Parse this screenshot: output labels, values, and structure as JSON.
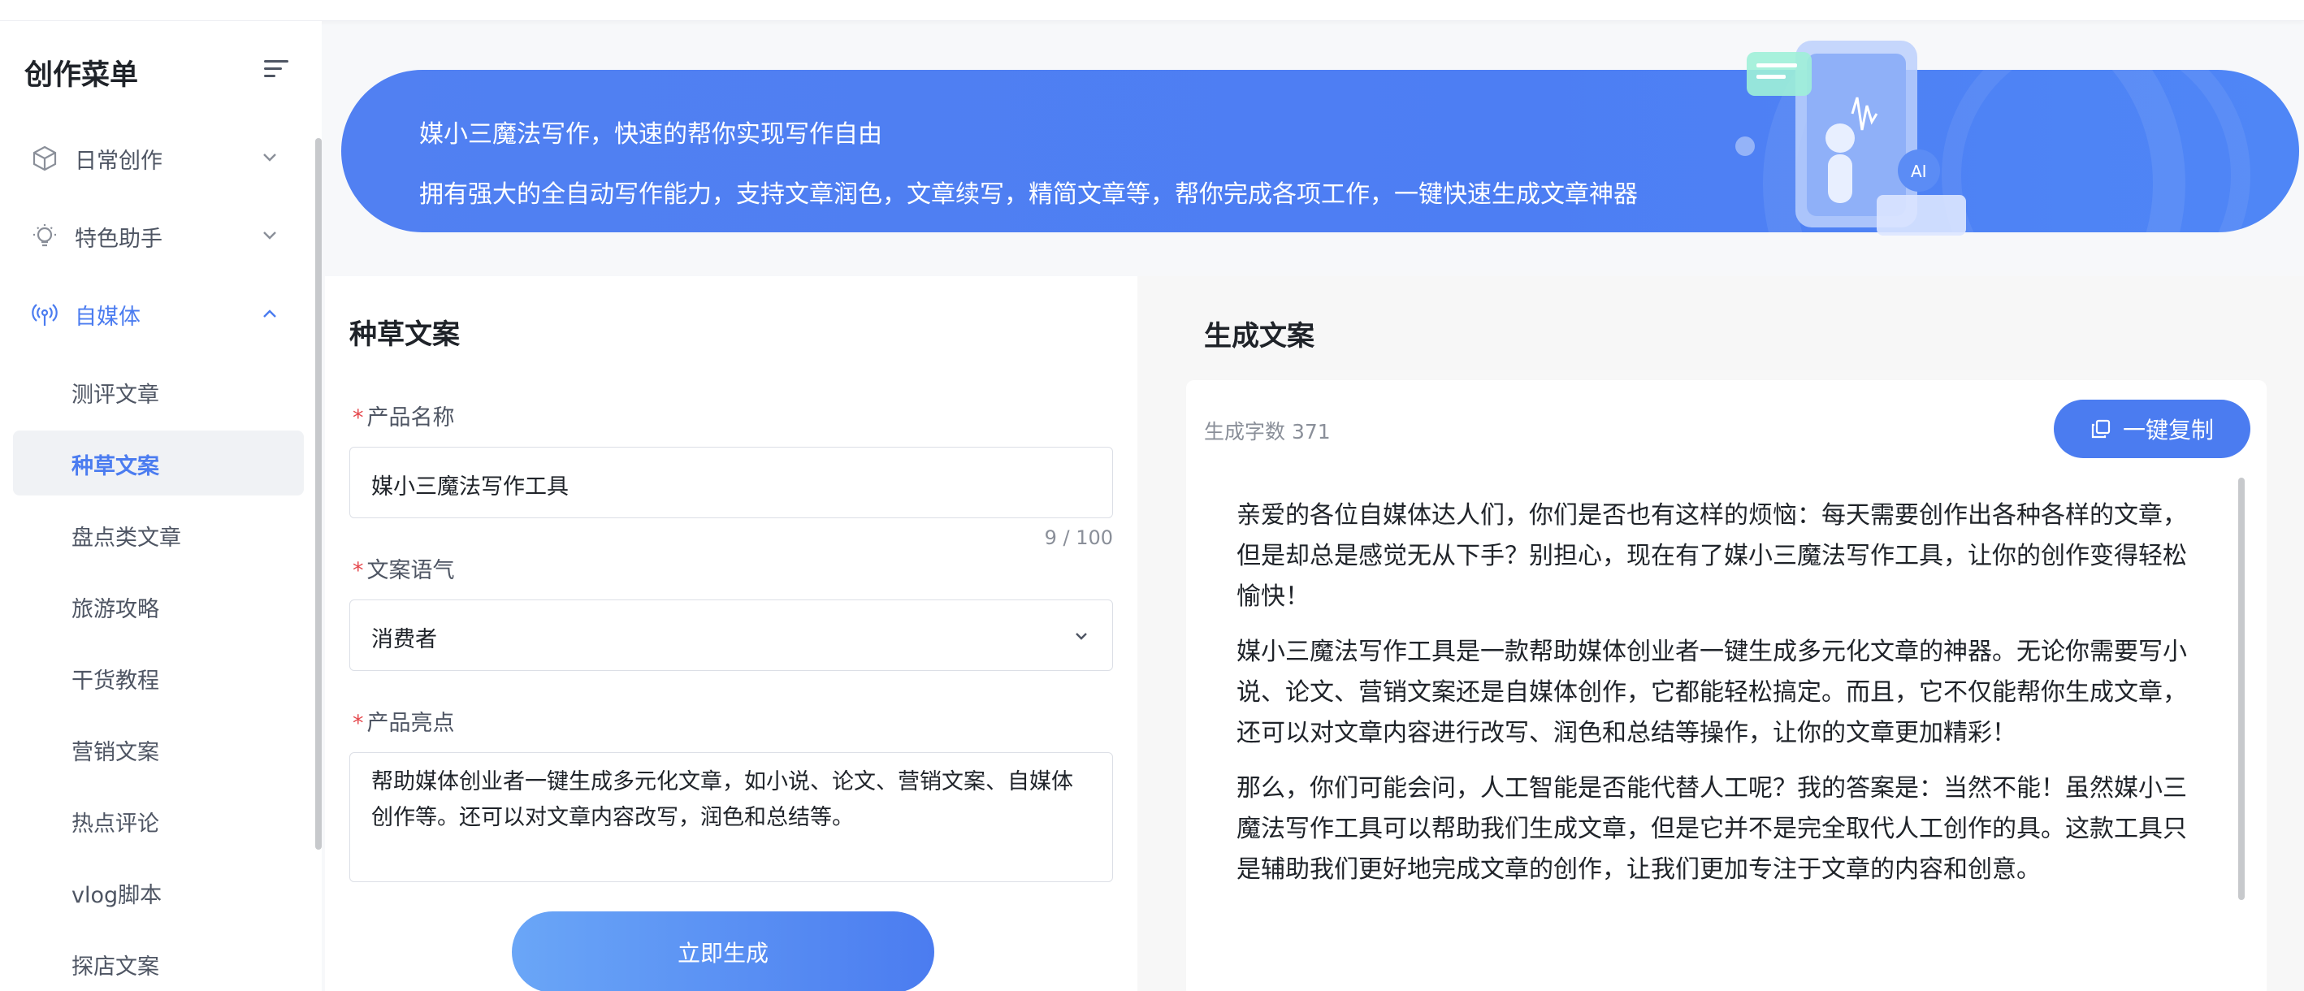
{
  "sidebar": {
    "title": "创作菜单",
    "groups": [
      {
        "label": "日常创作",
        "icon": "cube-icon",
        "expanded": false
      },
      {
        "label": "特色助手",
        "icon": "lightbulb-icon",
        "expanded": false
      },
      {
        "label": "自媒体",
        "icon": "broadcast-icon",
        "expanded": true
      }
    ],
    "items": [
      {
        "label": "测评文章"
      },
      {
        "label": "种草文案",
        "selected": true
      },
      {
        "label": "盘点类文章"
      },
      {
        "label": "旅游攻略"
      },
      {
        "label": "干货教程"
      },
      {
        "label": "营销文案"
      },
      {
        "label": "热点评论"
      },
      {
        "label": "vlog脚本"
      },
      {
        "label": "探店文案"
      }
    ]
  },
  "banner": {
    "line1": "媒小三魔法写作，快速的帮你实现写作自由",
    "line2": "拥有强大的全自动写作能力，支持文章润色，文章续写，精简文章等，帮你完成各项工作，一键快速生成文章神器"
  },
  "form": {
    "title": "种草文案",
    "product_name": {
      "label": "产品名称",
      "value": "媒小三魔法写作工具",
      "counter": "9 / 100"
    },
    "tone": {
      "label": "文案语气",
      "value": "消费者"
    },
    "highlights": {
      "label": "产品亮点",
      "value": "帮助媒体创业者一键生成多元化文章，如小说、论文、营销文案、自媒体创作等。还可以对文章内容改写，润色和总结等。"
    },
    "generate_label": "立即生成"
  },
  "output": {
    "title": "生成文案",
    "word_count": "生成字数 371",
    "copy_label": "一键复制",
    "paragraphs": [
      "亲爱的各位自媒体达人们，你们是否也有这样的烦恼：每天需要创作出各种各样的文章，但是却总是感觉无从下手？别担心，现在有了媒小三魔法写作工具，让你的创作变得轻松愉快！",
      "媒小三魔法写作工具是一款帮助媒体创业者一键生成多元化文章的神器。无论你需要写小说、论文、营销文案还是自媒体创作，它都能轻松搞定。而且，它不仅能帮你生成文章，还可以对文章内容进行改写、润色和总结等操作，让你的文章更加精彩！",
      "那么，你们可能会问，人工智能是否能代替人工呢？我的答案是：当然不能！虽然媒小三魔法写作工具可以帮助我们生成文章，但是它并不是完全取代人工创作的具。这款工具只是辅助我们更好地完成文章的创作，让我们更加专注于文章的内容和创意。"
    ]
  },
  "colors": {
    "accent": "#4b7cf0",
    "required": "#e5484d"
  }
}
